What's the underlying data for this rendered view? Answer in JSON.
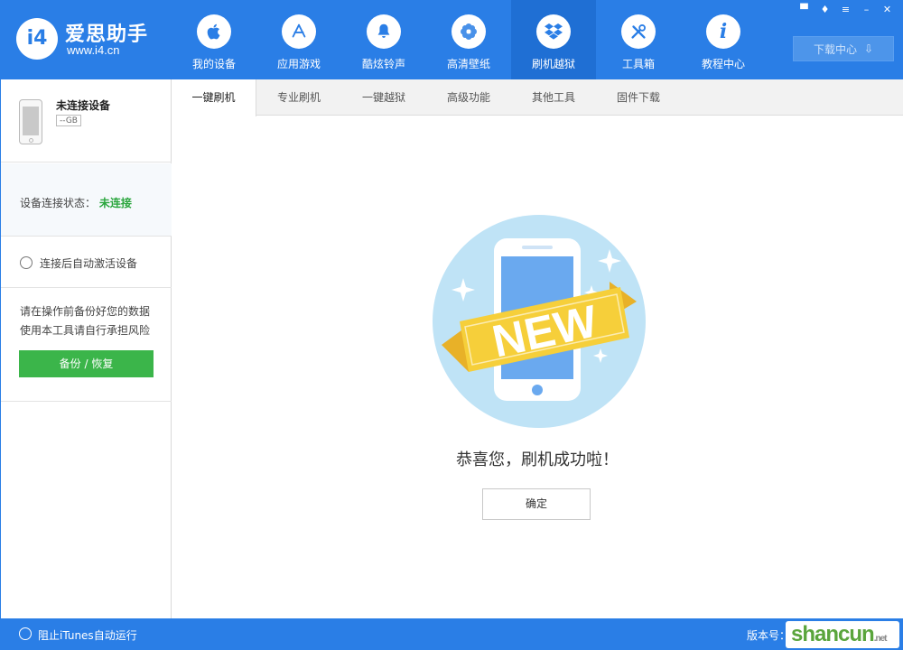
{
  "app": {
    "name": "爱思助手",
    "url": "www.i4.cn",
    "logo_text": "i4"
  },
  "nav": [
    {
      "label": "我的设备",
      "icon": "apple-icon"
    },
    {
      "label": "应用游戏",
      "icon": "app-store-icon"
    },
    {
      "label": "酷炫铃声",
      "icon": "bell-icon"
    },
    {
      "label": "高清壁纸",
      "icon": "flower-icon"
    },
    {
      "label": "刷机越狱",
      "icon": "dropbox-icon",
      "active": true
    },
    {
      "label": "工具箱",
      "icon": "tools-icon"
    },
    {
      "label": "教程中心",
      "icon": "info-icon"
    }
  ],
  "window_controls": [
    "feedback-icon",
    "skin-icon",
    "menu-icon",
    "minimize-icon",
    "close-icon"
  ],
  "download_center": "下载中心",
  "sidebar": {
    "device_name": "未连接设备",
    "device_capacity": "--GB",
    "status_label": "设备连接状态：",
    "status_value": "未连接",
    "auto_activate": "连接后自动激活设备",
    "warning_line1": "请在操作前备份好您的数据",
    "warning_line2": "使用本工具请自行承担风险",
    "backup_button": "备份 / 恢复"
  },
  "tabs": [
    {
      "label": "一键刷机",
      "active": true
    },
    {
      "label": "专业刷机"
    },
    {
      "label": "一键越狱"
    },
    {
      "label": "高级功能"
    },
    {
      "label": "其他工具"
    },
    {
      "label": "固件下载"
    }
  ],
  "main": {
    "badge": "NEW",
    "congrats": "恭喜您，刷机成功啦！",
    "ok_button": "确定"
  },
  "footer": {
    "itunes_toggle": "阻止iTunes自动运行",
    "version_label": "版本号："
  },
  "watermark": {
    "text": "shancun",
    "suffix": ".net"
  },
  "colors": {
    "brand_blue": "#2a7ee6",
    "active_nav": "#1f6fd4",
    "success_green": "#3bb54a",
    "status_green": "#2aa63d",
    "badge_yellow": "#f6cf3a"
  }
}
